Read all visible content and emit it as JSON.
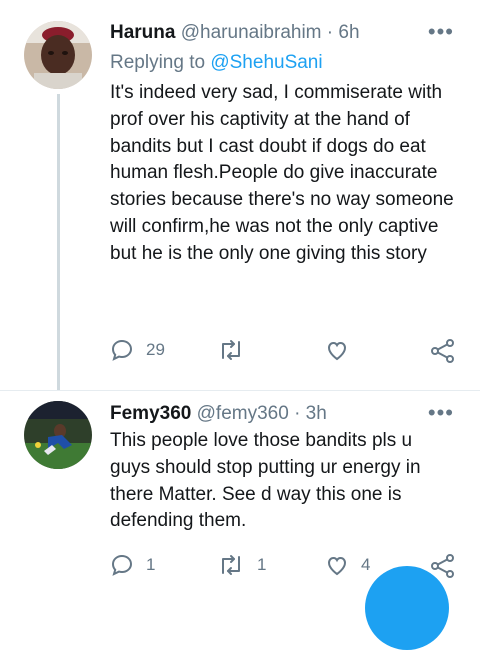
{
  "tweets": [
    {
      "name": "Haruna",
      "handle": "@harunaibrahim",
      "time": "· 6h",
      "replying_prefix": "Replying to",
      "replying_mention": "@ShehuSani",
      "text": "It's indeed very sad, I commiserate with prof over his captivity at the hand of bandits but I cast doubt if dogs do eat human flesh.People do give inaccurate stories because there's no way someone will confirm,he was not the only captive but he is the only one giving this story",
      "replies": "29",
      "retweets": "",
      "likes": ""
    },
    {
      "name": "Femy360",
      "handle": "@femy360",
      "time": "· 3h",
      "text": "This people love those bandits pls u guys should stop putting ur energy in there Matter. See d way this one is defending them.",
      "replies": "1",
      "retweets": "1",
      "likes": "4"
    }
  ],
  "more_label": "•••",
  "icons": {
    "reply": "reply-icon",
    "retweet": "retweet-icon",
    "like": "heart-icon",
    "share": "share-icon"
  },
  "colors": {
    "accent": "#1da1f2",
    "muted": "#657786",
    "text": "#14171a"
  }
}
